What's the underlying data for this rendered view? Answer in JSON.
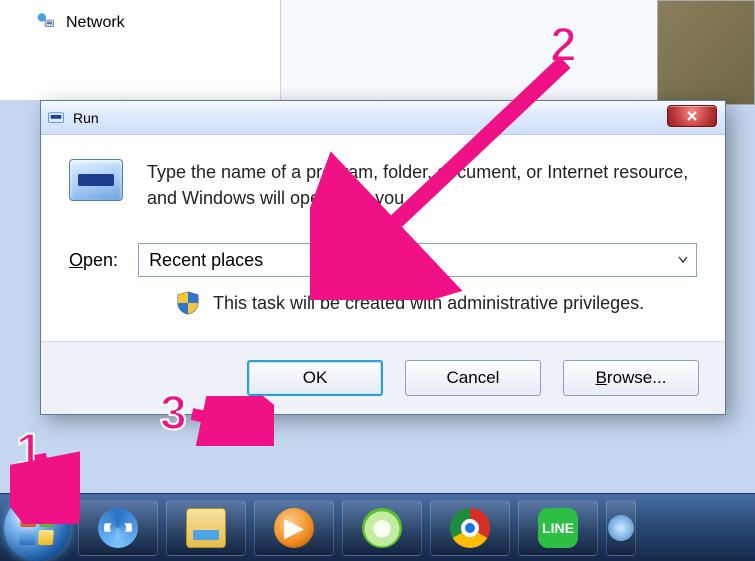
{
  "desktop": {
    "network_label": "Network"
  },
  "run": {
    "title": "Run",
    "instruction": "Type the name of a program, folder, document, or Internet resource, and Windows will open it for you.",
    "open_label_prefix": "O",
    "open_label_rest": "pen:",
    "input_value": "Recent places",
    "admin_text": "This task will be created with administrative privileges.",
    "ok_label": "OK",
    "cancel_label": "Cancel",
    "browse_label_prefix": "B",
    "browse_label_rest": "rowse..."
  },
  "taskbar": {
    "line_label": "LINE"
  },
  "annotations": {
    "one": "1",
    "two": "2",
    "three": "3"
  }
}
